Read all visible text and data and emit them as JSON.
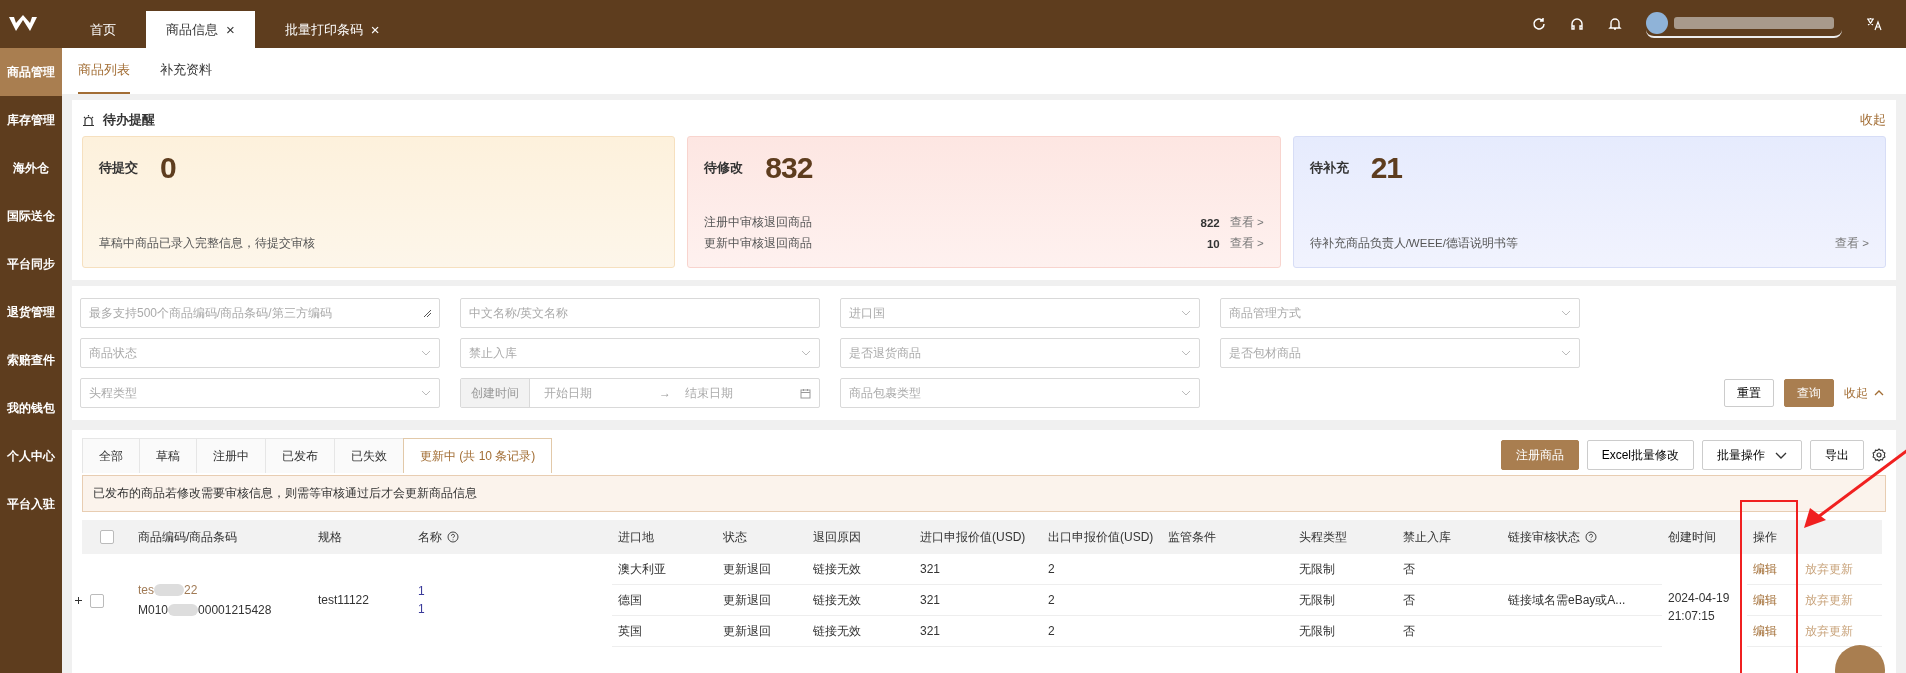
{
  "topbar": {
    "tabs": [
      {
        "label": "首页",
        "selected": false,
        "closable": false
      },
      {
        "label": "商品信息",
        "selected": true,
        "closable": true
      },
      {
        "label": "批量打印条码",
        "selected": false,
        "closable": true
      }
    ],
    "close_mark": "×"
  },
  "sidebar": {
    "items": [
      {
        "label": "商品管理",
        "selected": true
      },
      {
        "label": "库存管理",
        "selected": false
      },
      {
        "label": "海外仓",
        "selected": false
      },
      {
        "label": "国际送仓",
        "selected": false
      },
      {
        "label": "平台同步",
        "selected": false
      },
      {
        "label": "退货管理",
        "selected": false
      },
      {
        "label": "索赔查件",
        "selected": false
      },
      {
        "label": "我的钱包",
        "selected": false
      },
      {
        "label": "个人中心",
        "selected": false
      },
      {
        "label": "平台入驻",
        "selected": false
      }
    ]
  },
  "subtabs": [
    {
      "label": "商品列表",
      "selected": true
    },
    {
      "label": "补充资料",
      "selected": false
    }
  ],
  "reminder": {
    "title": "待办提醒",
    "collapse_label": "收起",
    "cards": [
      {
        "kind": "draft",
        "title": "待提交",
        "count": "0",
        "lines": [
          {
            "text": "草稿中商品已录入完整信息，待提交审核"
          }
        ]
      },
      {
        "kind": "modify",
        "title": "待修改",
        "count": "832",
        "lines": [
          {
            "text": "注册中审核退回商品",
            "count": "822",
            "link": "查看 >"
          },
          {
            "text": "更新中审核退回商品",
            "count": "10",
            "link": "查看 >"
          }
        ]
      },
      {
        "kind": "supplement",
        "title": "待补充",
        "count": "21",
        "lines": [
          {
            "text": "待补充商品负责人/WEEE/德语说明书等",
            "link": "查看 >"
          }
        ]
      }
    ]
  },
  "filters": {
    "rows": [
      [
        {
          "kind": "textarea",
          "placeholder": "最多支持500个商品编码/商品条码/第三方编码"
        },
        {
          "kind": "input",
          "placeholder": "中文名称/英文名称"
        },
        {
          "kind": "select",
          "placeholder": "进口国"
        },
        {
          "kind": "select",
          "placeholder": "商品管理方式"
        }
      ],
      [
        {
          "kind": "select",
          "placeholder": "商品状态"
        },
        {
          "kind": "select",
          "placeholder": "禁止入库"
        },
        {
          "kind": "select",
          "placeholder": "是否退货商品"
        },
        {
          "kind": "select",
          "placeholder": "是否包材商品"
        }
      ],
      [
        {
          "kind": "select",
          "placeholder": "头程类型"
        },
        {
          "kind": "daterange",
          "label": "创建时间",
          "start_placeholder": "开始日期",
          "separator": "→",
          "end_placeholder": "结束日期"
        },
        {
          "kind": "select",
          "placeholder": "商品包裹类型"
        }
      ]
    ],
    "reset_label": "重置",
    "query_label": "查询",
    "collapse_label": "收起"
  },
  "status_tabs": [
    {
      "label": "全部",
      "selected": false
    },
    {
      "label": "草稿",
      "selected": false
    },
    {
      "label": "注册中",
      "selected": false
    },
    {
      "label": "已发布",
      "selected": false
    },
    {
      "label": "已失效",
      "selected": false
    },
    {
      "label": "更新中 (共 10 条记录)",
      "selected": true
    }
  ],
  "actions": [
    {
      "label": "注册商品",
      "kind": "primary"
    },
    {
      "label": "Excel批量修改",
      "kind": "default"
    },
    {
      "label": "批量操作",
      "kind": "dropdown"
    },
    {
      "label": "导出",
      "kind": "default"
    }
  ],
  "notice": "已发布的商品若修改需要审核信息，则需等审核通过后才会更新商品信息",
  "table": {
    "columns": [
      {
        "label": "商品编码/商品条码",
        "help": false
      },
      {
        "label": "规格",
        "help": false
      },
      {
        "label": "名称",
        "help": true
      },
      {
        "label": "进口地",
        "help": false
      },
      {
        "label": "状态",
        "help": false
      },
      {
        "label": "退回原因",
        "help": false
      },
      {
        "label": "进口申报价值(USD)",
        "help": false
      },
      {
        "label": "出口申报价值(USD)",
        "help": false
      },
      {
        "label": "监管条件",
        "help": false
      },
      {
        "label": "头程类型",
        "help": false
      },
      {
        "label": "禁止入库",
        "help": false
      },
      {
        "label": "链接审核状态",
        "help": true
      },
      {
        "label": "创建时间",
        "help": false
      },
      {
        "label": "操作",
        "help": false
      }
    ],
    "header_checked": false,
    "products": [
      {
        "checked": false,
        "expanded": false,
        "code_start": "tes",
        "code_end": "22",
        "barcode_start": "M010",
        "barcode_end": "00001215428",
        "spec": "test11122",
        "names": [
          "1",
          "1"
        ],
        "created": [
          "2024-04-19",
          "21:07:15"
        ],
        "rows": [
          {
            "import": "澳大利亚",
            "status": "更新退回",
            "reason": "链接无效",
            "import_value": "321",
            "export_value": "2",
            "head": "无限制",
            "forbid": "否",
            "ops": [
              "编辑",
              "放弃更新"
            ]
          },
          {
            "import": "德国",
            "status": "更新退回",
            "reason": "链接无效",
            "import_value": "321",
            "export_value": "2",
            "head": "无限制",
            "forbid": "否",
            "link_status": "链接域名需eBay或A...",
            "ops": [
              "编辑",
              "放弃更新"
            ]
          },
          {
            "import": "英国",
            "status": "更新退回",
            "reason": "链接无效",
            "import_value": "321",
            "export_value": "2",
            "head": "无限制",
            "forbid": "否",
            "ops": [
              "编辑",
              "放弃更新"
            ]
          }
        ]
      }
    ]
  }
}
